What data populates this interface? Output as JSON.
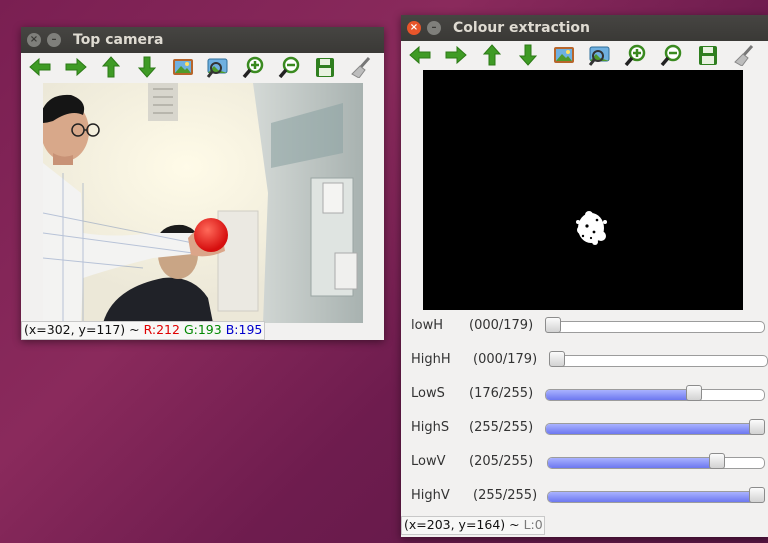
{
  "windows": {
    "top_camera": {
      "title": "Top camera",
      "close_icon": "×",
      "min_icon": "–",
      "toolbar": [
        "pan-left-icon",
        "pan-right-icon",
        "pan-up-icon",
        "pan-down-icon",
        "save-image-icon",
        "zoom-fit-icon",
        "zoom-in-icon",
        "zoom-out-icon",
        "save-icon",
        "properties-icon"
      ],
      "status": {
        "coords": "(x=302, y=117) ~ ",
        "r": "R:212",
        "g": "G:193",
        "b": "B:195"
      }
    },
    "colour_extraction": {
      "title": "Colour extraction",
      "close_icon": "×",
      "min_icon": "–",
      "status": {
        "coords": "(x=203, y=164) ~ ",
        "l": "L:0"
      },
      "sliders": [
        {
          "label": "lowH",
          "value_text": "(000/179)",
          "value": 0,
          "max": 179
        },
        {
          "label": "HighH",
          "value_text": "(000/179)",
          "value": 0,
          "max": 179
        },
        {
          "label": "LowS",
          "value_text": "(176/255)",
          "value": 176,
          "max": 255
        },
        {
          "label": "HighS",
          "value_text": "(255/255)",
          "value": 255,
          "max": 255
        },
        {
          "label": "LowV",
          "value_text": "(205/255)",
          "value": 205,
          "max": 255
        },
        {
          "label": "HighV",
          "value_text": "(255/255)",
          "value": 255,
          "max": 255
        }
      ]
    }
  },
  "colors": {
    "accent_red": "#e8552a",
    "status_r": "#e00000",
    "status_g": "#008800",
    "status_b": "#0000cc",
    "status_l": "#7a7a7a"
  }
}
